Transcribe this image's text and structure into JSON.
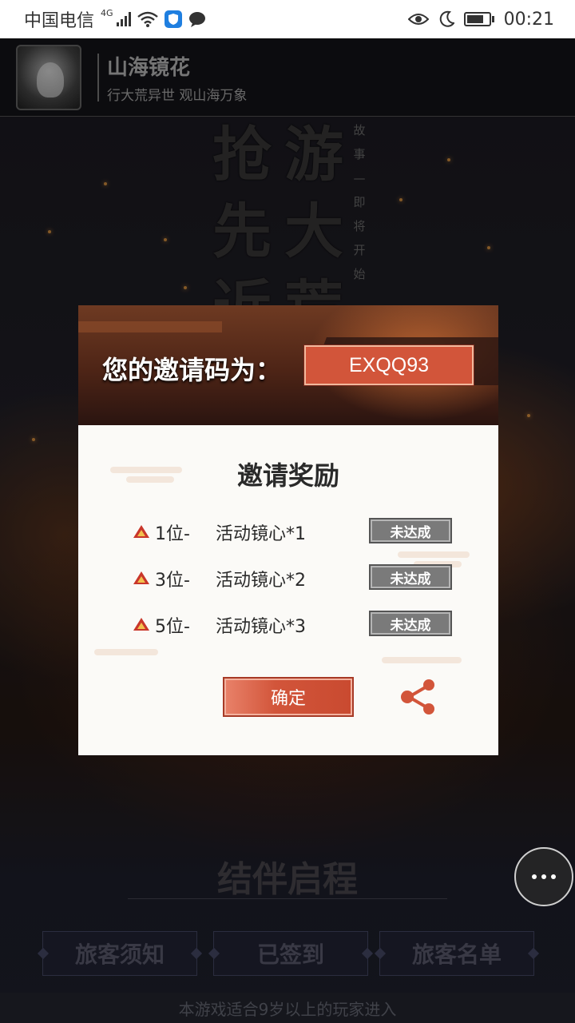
{
  "status_bar": {
    "carrier": "中国电信",
    "network": "4G",
    "time": "00:21"
  },
  "app": {
    "title": "山海镜花",
    "subtitle": "行大荒异世 观山海万象"
  },
  "poster": {
    "title_col_right": [
      "游",
      "大",
      "荒"
    ],
    "title_col_left": [
      "抢",
      "先",
      "近"
    ],
    "vertical_text": [
      "故",
      "事",
      "—",
      "即",
      "将",
      "开",
      "始"
    ]
  },
  "dialog": {
    "invite_label": "您的邀请码为：",
    "invite_code": "EXQQ93",
    "reward_title": "邀请奖励",
    "rewards": [
      {
        "rank": "1位-",
        "item": "活动镜心*1",
        "status": "未达成"
      },
      {
        "rank": "3位-",
        "item": "活动镜心*2",
        "status": "未达成"
      },
      {
        "rank": "5位-",
        "item": "活动镜心*3",
        "status": "未达成"
      }
    ],
    "confirm_label": "确定"
  },
  "page": {
    "section_title": "结伴启程",
    "buttons": [
      "旅客须知",
      "已签到",
      "旅客名单"
    ],
    "age_notice": "本游戏适合9岁以上的玩家进入"
  },
  "colors": {
    "accent": "#d2553a",
    "status_disabled": "#7a7a7a"
  }
}
